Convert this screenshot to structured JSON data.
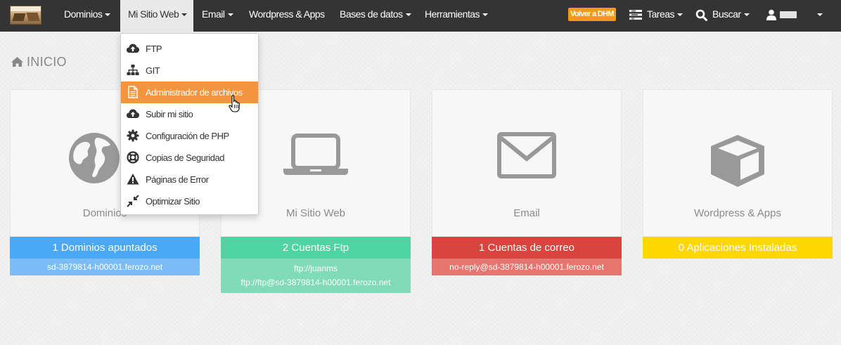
{
  "navbar": {
    "logo": "logo",
    "items": [
      {
        "label": "Dominios"
      },
      {
        "label": "Mi Sitio Web"
      },
      {
        "label": "Email"
      },
      {
        "label": "Wordpress & Apps"
      },
      {
        "label": "Bases de datos"
      },
      {
        "label": "Herramientas"
      }
    ],
    "volver_label": "Volver a DHM",
    "tareas_label": "Tareas",
    "buscar_label": "Buscar",
    "user_label": ""
  },
  "page": {
    "title": "INICIO"
  },
  "dropdown": {
    "items": [
      {
        "label": "FTP",
        "icon": "cloud-upload-icon"
      },
      {
        "label": "GIT",
        "icon": "sitemap-icon"
      },
      {
        "label": "Administrador de archivos",
        "icon": "file-icon"
      },
      {
        "label": "Subir mi sitio",
        "icon": "cloud-upload-icon"
      },
      {
        "label": "Configuración de PHP",
        "icon": "gear-icon"
      },
      {
        "label": "Copias de Seguridad",
        "icon": "life-ring-icon"
      },
      {
        "label": "Páginas de Error",
        "icon": "warning-icon"
      },
      {
        "label": "Optimizar Sitio",
        "icon": "compress-icon"
      }
    ],
    "highlighted_index": 2
  },
  "cards": [
    {
      "label": "Dominios",
      "icon": "globe-icon",
      "bar": "1 Dominios apuntados",
      "bar_color": "#4aa8f7",
      "sub_color": "#7abdf6",
      "sub_lines": [
        "sd-3879814-h00001.ferozo.net"
      ]
    },
    {
      "label": "Mi Sitio Web",
      "icon": "laptop-icon",
      "bar": "2 Cuentas Ftp",
      "bar_color": "#4fd4a4",
      "sub_color": "#7fdbb8",
      "sub_lines": [
        "ftp://juanms",
        "ftp://ftp@sd-3879814-h00001.ferozo.net"
      ]
    },
    {
      "label": "Email",
      "icon": "envelope-icon",
      "bar": "1 Cuentas de correo",
      "bar_color": "#d9443f",
      "sub_color": "#e6756f",
      "sub_lines": [
        "no-reply@sd-3879814-h00001.ferozo.net"
      ]
    },
    {
      "label": "Wordpress & Apps",
      "icon": "cube-icon",
      "bar": "0 Aplicaciones Instaladas",
      "bar_color": "#ffd700",
      "sub_color": "",
      "sub_lines": []
    }
  ],
  "colors": {
    "navbar_bg": "#343434",
    "accent_orange": "#f3953e"
  }
}
